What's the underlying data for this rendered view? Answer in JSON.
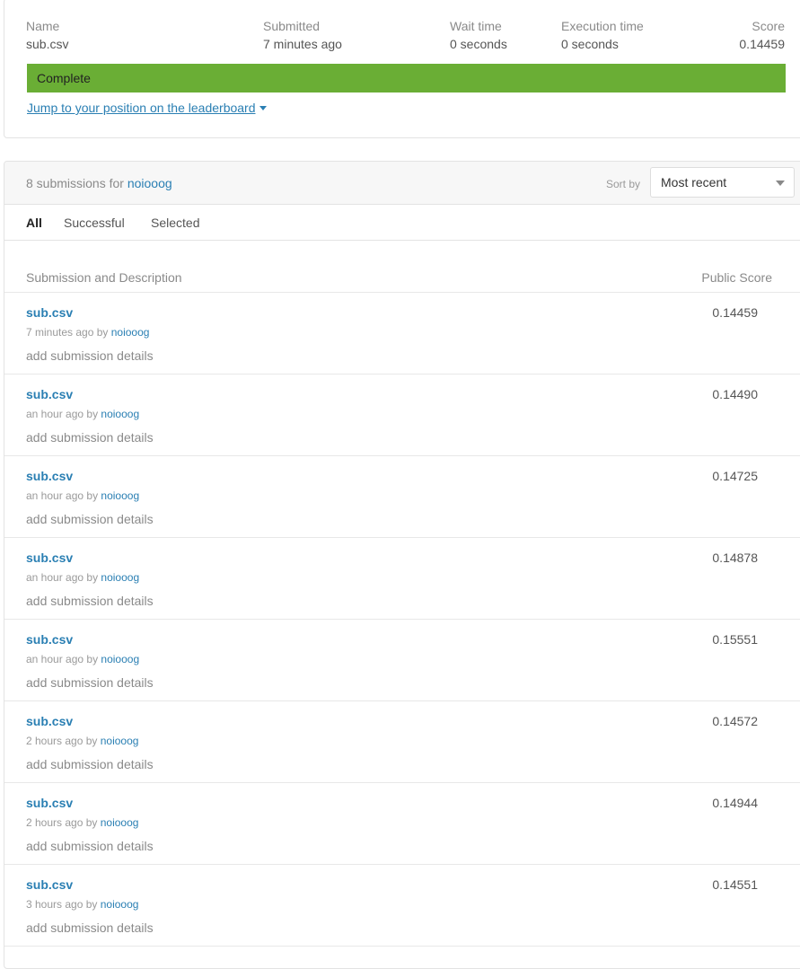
{
  "summary": {
    "columns": [
      {
        "header": "Name",
        "value": "sub.csv"
      },
      {
        "header": "Submitted",
        "value": "7 minutes ago"
      },
      {
        "header": "Wait time",
        "value": "0 seconds"
      },
      {
        "header": "Execution time",
        "value": "0 seconds"
      },
      {
        "header": "Score",
        "value": "0.14459"
      }
    ],
    "status": "Complete",
    "status_color": "#6aae35",
    "jump_link": "Jump to your position on the leaderboard"
  },
  "submissions": {
    "count_text": "8 submissions for",
    "user": "noiooog",
    "sort_label": "Sort by",
    "sort_value": "Most recent",
    "tabs": [
      "All",
      "Successful",
      "Selected"
    ],
    "active_tab": "All",
    "col_description": "Submission and Description",
    "col_score": "Public Score",
    "rows": [
      {
        "file": "sub.csv",
        "time": "7 minutes ago by",
        "user": "noiooog",
        "desc": "add submission details",
        "score": "0.14459"
      },
      {
        "file": "sub.csv",
        "time": "an hour ago by",
        "user": "noiooog",
        "desc": "add submission details",
        "score": "0.14490"
      },
      {
        "file": "sub.csv",
        "time": "an hour ago by",
        "user": "noiooog",
        "desc": "add submission details",
        "score": "0.14725"
      },
      {
        "file": "sub.csv",
        "time": "an hour ago by",
        "user": "noiooog",
        "desc": "add submission details",
        "score": "0.14878"
      },
      {
        "file": "sub.csv",
        "time": "an hour ago by",
        "user": "noiooog",
        "desc": "add submission details",
        "score": "0.15551"
      },
      {
        "file": "sub.csv",
        "time": "2 hours ago by",
        "user": "noiooog",
        "desc": "add submission details",
        "score": "0.14572"
      },
      {
        "file": "sub.csv",
        "time": "2 hours ago by",
        "user": "noiooog",
        "desc": "add submission details",
        "score": "0.14944"
      },
      {
        "file": "sub.csv",
        "time": "3 hours ago by",
        "user": "noiooog",
        "desc": "add submission details",
        "score": "0.14551"
      }
    ]
  },
  "colors": {
    "link": "#2a7fb3",
    "muted": "#8a8a8a"
  }
}
